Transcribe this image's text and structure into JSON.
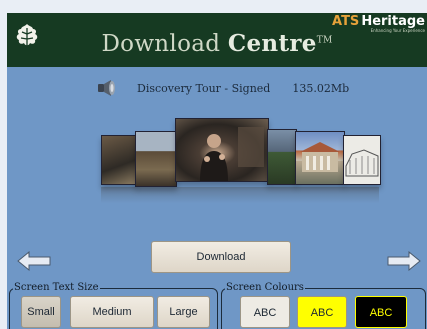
{
  "header": {
    "title_light": "Download",
    "title_bold": "Centre",
    "title_mark": "TM",
    "brand_prefix": "ATS",
    "brand_name": "Heritage",
    "brand_tagline": "Enhancing Your Experience"
  },
  "file": {
    "name": "Discovery Tour - Signed",
    "size": "135.02Mb"
  },
  "actions": {
    "download_label": "Download"
  },
  "text_size": {
    "label": "Screen Text Size",
    "options": [
      "Small",
      "Medium",
      "Large"
    ],
    "selected": "Small"
  },
  "colours": {
    "label": "Screen Colours",
    "options": [
      {
        "label": "ABC",
        "bg": "#eeebe4",
        "fg": "#1c2733"
      },
      {
        "label": "ABC",
        "bg": "#ffff00",
        "fg": "#1c2733"
      },
      {
        "label": "ABC",
        "bg": "#000000",
        "fg": "#ffff00"
      }
    ]
  },
  "icons": {
    "logo": "oak-leaf-icon",
    "speaker": "speaker-icon",
    "prev": "arrow-left-icon",
    "next": "arrow-right-icon"
  },
  "palette": {
    "screen_bg": "#6f97c6",
    "header_bg": "#163a22",
    "brand_accent": "#e7a23a"
  }
}
